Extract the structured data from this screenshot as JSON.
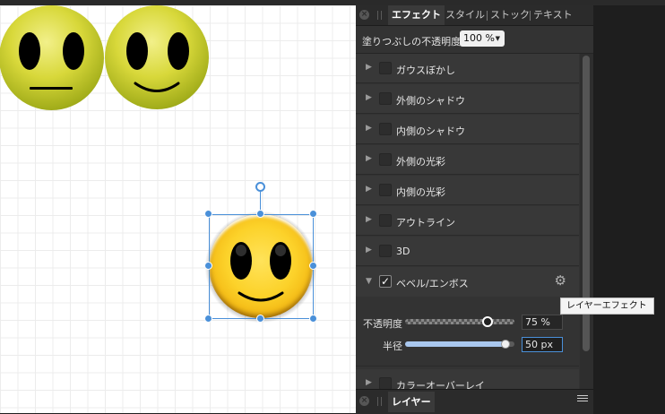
{
  "panel": {
    "tabs": [
      {
        "label": "エフェクト",
        "active": true
      },
      {
        "label": "スタイル"
      },
      {
        "label": "ストック"
      },
      {
        "label": "テキスト"
      }
    ],
    "fill_opacity_label": "塗りつぶしの不透明度:",
    "fill_opacity_value": "100 %",
    "effects": [
      {
        "label": "ガウスぼかし",
        "checked": false,
        "expanded": false
      },
      {
        "label": "外側のシャドウ",
        "checked": false,
        "expanded": false
      },
      {
        "label": "内側のシャドウ",
        "checked": false,
        "expanded": false
      },
      {
        "label": "外側の光彩",
        "checked": false,
        "expanded": false
      },
      {
        "label": "内側の光彩",
        "checked": false,
        "expanded": false
      },
      {
        "label": "アウトライン",
        "checked": false,
        "expanded": false
      },
      {
        "label": "3D",
        "checked": false,
        "expanded": false
      },
      {
        "label": "ベベル/エンボス",
        "checked": true,
        "expanded": true
      },
      {
        "label": "カラーオーバーレイ",
        "checked": false,
        "expanded": false
      }
    ],
    "bevel": {
      "opacity_label": "不透明度",
      "opacity_value": "75 %",
      "opacity_fraction": 0.75,
      "radius_label": "半径",
      "radius_value": "50 px",
      "radius_fraction": 0.92
    },
    "layers_tab": "レイヤー",
    "tooltip": "レイヤーエフェクト"
  },
  "icons": {
    "close": "close-icon",
    "grip": "grip-icon",
    "expand": "disclosure-triangle-icon",
    "gear": "gear-icon",
    "menu": "panel-menu-icon",
    "dropdown": "chevron-down-icon"
  },
  "colors": {
    "accent": "#4a90d9",
    "panel_bg": "#333333",
    "face_olive": "#a2ad1a",
    "face_yellow": "#f7c21a"
  }
}
